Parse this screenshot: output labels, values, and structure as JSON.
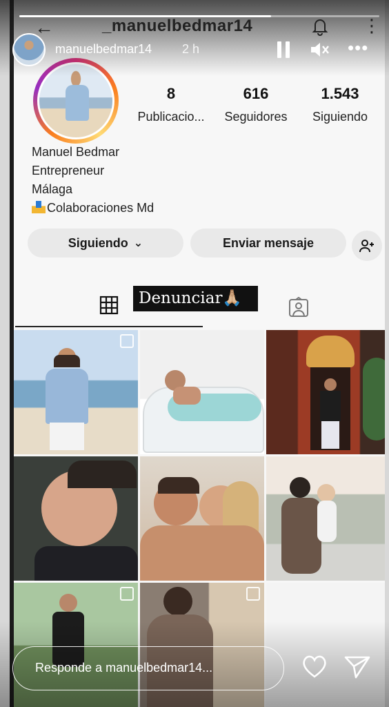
{
  "instagram": {
    "username_header": "_manuelbedmar14",
    "profile": {
      "display_name": "Manuel Bedmar",
      "bio_line1": "Entrepreneur",
      "bio_line2": "Málaga",
      "bio_line3": "Colaboraciones Md",
      "stats": [
        {
          "value": "8",
          "label": "Publicacio..."
        },
        {
          "value": "616",
          "label": "Seguidores"
        },
        {
          "value": "1.543",
          "label": "Siguiendo"
        }
      ]
    },
    "buttons": {
      "following": "Siguiendo",
      "following_caret": "⌄",
      "message": "Enviar mensaje"
    }
  },
  "story": {
    "username": "manuelbedmar14",
    "time": "2 h",
    "progress": 0.7,
    "reply_placeholder": "Responde a manuelbedmar14...",
    "options_glyph": "•••",
    "sticker_text": "Denunciar🙏🏼"
  },
  "icons": {
    "back": "←",
    "vertical_more": "⋮"
  },
  "colors": {
    "ring": "#d62976",
    "button_bg": "#e9e9e9",
    "sticker_bg": "#111111"
  }
}
